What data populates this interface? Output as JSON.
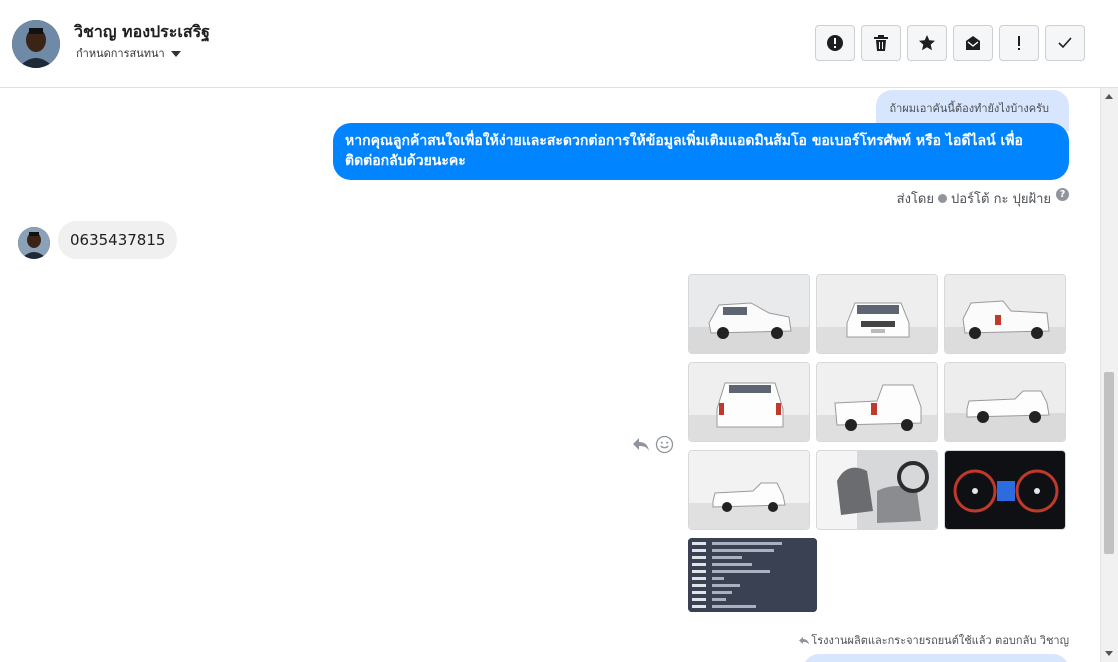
{
  "header": {
    "contact_name": "วิชาญ ทองประเสริฐ",
    "assign_label": "กำหนดการสนทนา",
    "actions": [
      {
        "name": "spam-alert-button",
        "icon": "alert-circle-icon"
      },
      {
        "name": "delete-button",
        "icon": "trash-icon"
      },
      {
        "name": "star-button",
        "icon": "star-icon"
      },
      {
        "name": "mark-unread-button",
        "icon": "envelope-icon"
      },
      {
        "name": "follow-up-button",
        "icon": "exclamation-icon"
      },
      {
        "name": "mark-done-button",
        "icon": "check-icon"
      }
    ]
  },
  "conversation": {
    "quoted_text": "ถ้าผมเอาคันนี้ต้องทำยังไงบ้างครับ",
    "page_message": "หากคุณลูกค้าสนใจเพื่อให้ง่ายและสะดวกต่อการให้ข้อมูลเพิ่มเติมแอดมินส้มโอ ขอเบอร์โทรศัพท์ หรือ ไอดีไลน์ เพื่อติดต่อกลับด้วยนะคะ",
    "sent_by_label": "ส่งโดย",
    "sent_by_name": "ปอร์โต้ กะ ปุยฝ้าย",
    "customer_message": "0635437815",
    "reply_footer": "โรงงานผลิตและกระจายรถยนต์ใช้แล้ว ตอบกลับ วิชาญ",
    "photos": [
      {
        "name": "photo-front-left",
        "view": "front-left"
      },
      {
        "name": "photo-front",
        "view": "front"
      },
      {
        "name": "photo-rear-right",
        "view": "rear-right"
      },
      {
        "name": "photo-rear",
        "view": "rear"
      },
      {
        "name": "photo-rear-left",
        "view": "rear-left"
      },
      {
        "name": "photo-side",
        "view": "side"
      },
      {
        "name": "photo-side-far",
        "view": "side-far"
      },
      {
        "name": "photo-interior",
        "view": "interior"
      },
      {
        "name": "photo-dashboard",
        "view": "dashboard"
      }
    ]
  },
  "colors": {
    "page_bubble": "#0084ff",
    "quote_bubble": "#d7e6fc",
    "customer_bubble": "#f1f0f0"
  }
}
